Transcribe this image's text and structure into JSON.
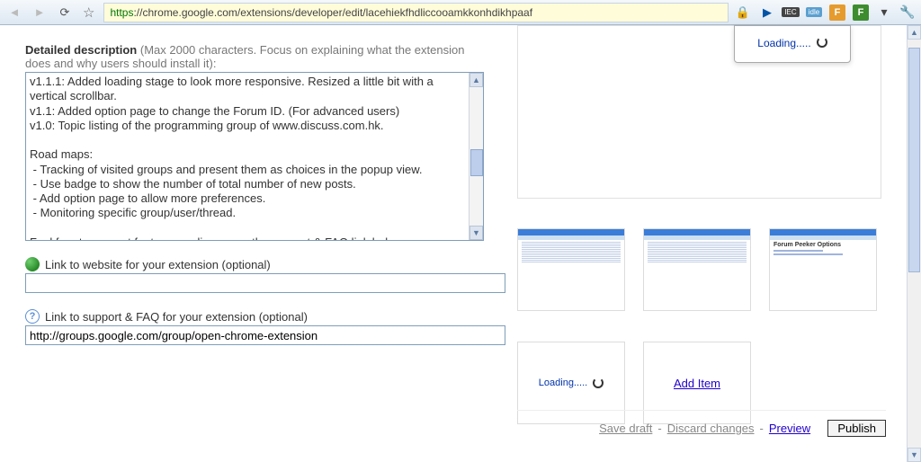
{
  "browser": {
    "url_proto": "https",
    "url_rest": "://chrome.google.com/extensions/developer/edit/lacehiekfhdliccooamkkonhdikhpaaf",
    "iec_label": "IEC",
    "idle_label": "idle",
    "f_label": "F"
  },
  "popup": {
    "loading": "Loading....."
  },
  "left": {
    "detailed_label": "Detailed description",
    "detailed_hint": " (Max 2000 characters. Focus on explaining what the extension does and why users should install it):",
    "description_value": "v1.1.1: Added loading stage to look more responsive. Resized a little bit with a vertical scrollbar.\nv1.1: Added option page to change the Forum ID. (For advanced users)\nv1.0: Topic listing of the programming group of www.discuss.com.hk.\n\nRoad maps:\n - Tracking of visited groups and present them as choices in the popup view.\n - Use badge to show the number of total number of new posts.\n - Add option page to allow more preferences.\n - Monitoring specific group/user/thread.\n\nFeel free to request features or discuss on the support & FAQ link below.",
    "website_label": "Link to website for your extension (optional)",
    "website_value": "",
    "faq_label": "Link to support & FAQ for your extension (optional)",
    "faq_value": "http://groups.google.com/group/open-chrome-extension"
  },
  "right": {
    "preview_loading": "Loading.....",
    "cell_loading": "Loading.....",
    "add_item": "Add Item"
  },
  "actions": {
    "save_draft": "Save draft",
    "discard": "Discard changes",
    "preview": "Preview",
    "publish": "Publish",
    "sep": " - "
  },
  "thumbs": {
    "opt_title": "Forum Peeker Options"
  }
}
